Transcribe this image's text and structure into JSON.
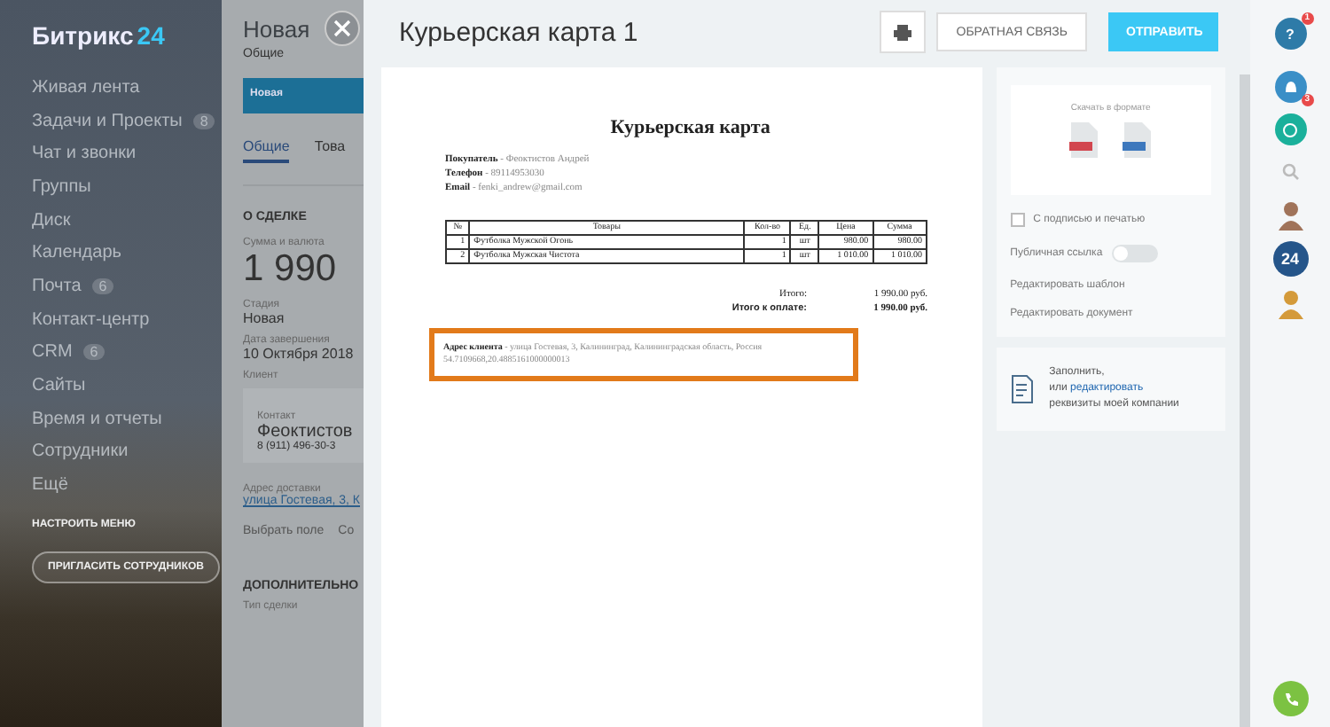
{
  "sidebar": {
    "logo": "Битрикс",
    "logo_suffix": "24",
    "items": [
      {
        "label": "Живая лента"
      },
      {
        "label": "Задачи и Проекты",
        "badge": "8"
      },
      {
        "label": "Чат и звонки"
      },
      {
        "label": "Группы"
      },
      {
        "label": "Диск"
      },
      {
        "label": "Календарь"
      },
      {
        "label": "Почта",
        "badge": "6"
      },
      {
        "label": "Контакт-центр"
      },
      {
        "label": "CRM",
        "badge": "6"
      },
      {
        "label": "Сайты"
      },
      {
        "label": "Время и отчеты"
      },
      {
        "label": "Сотрудники"
      },
      {
        "label": "Ещё"
      }
    ],
    "configure_menu": "НАСТРОИТЬ МЕНЮ",
    "invite": "ПРИГЛАСИТЬ СОТРУДНИКОВ"
  },
  "deal": {
    "title": "Новая",
    "category": "Общие",
    "stage": "Новая",
    "tabs": [
      {
        "label": "Общие",
        "selected": true
      },
      {
        "label": "Това",
        "selected": false
      }
    ],
    "section": "О СДЕЛКЕ",
    "fields": [
      {
        "label": "Сумма и валюта",
        "value": "1 990",
        "kind": "big"
      },
      {
        "label": "Стадия",
        "value": "Новая",
        "kind": "text"
      },
      {
        "label": "Дата завершения",
        "value": "10 Октября 2018",
        "kind": "text"
      },
      {
        "label": "Клиент",
        "kind": "client"
      }
    ],
    "contact": {
      "label": "Контакт",
      "name": "Феоктистов",
      "phone": "8 (911) 496-30-3"
    },
    "address_label": "Адрес доставки",
    "address": "улица Гостевая, 3, К",
    "links": [
      "Выбрать поле",
      "Со"
    ],
    "section2": "ДОПОЛНИТЕЛЬНО",
    "field2": "Тип сделки"
  },
  "panel": {
    "title": "Курьерская карта 1",
    "feedback": "ОБРАТНАЯ СВЯЗЬ",
    "send": "ОТПРАВИТЬ",
    "document": {
      "heading": "Курьерская карта",
      "info": [
        {
          "label": "Покупатель",
          "value": "- Феоктистов Андрей"
        },
        {
          "label": "Телефон",
          "value": "- 89114953030"
        },
        {
          "label": "Email",
          "value": "- fenki_andrew@gmail.com"
        }
      ],
      "columns": [
        "№",
        "Товары",
        "Кол-во",
        "Ед.",
        "Цена",
        "Сумма"
      ],
      "rows": [
        [
          "1",
          "Футболка Мужской Огонь",
          "1",
          "шт",
          "980.00",
          "980.00"
        ],
        [
          "2",
          "Футболка Мужская Чистота",
          "1",
          "шт",
          "1 010.00",
          "1 010.00"
        ]
      ],
      "totals": [
        {
          "label": "Итого:",
          "value": "1 990.00 руб.",
          "bold": false
        },
        {
          "label": "Итого к оплате:",
          "value": "1 990.00 руб.",
          "bold": true
        }
      ],
      "address_label": "Адрес клиента",
      "address": "- улица Гостевая, 3, Калининград, Калининградская область, Россия 54.7109668,20.4885161000000013"
    },
    "download_label": "Скачать в формате",
    "signature": {
      "label": "С подписью и печатью",
      "checked": false
    },
    "public_link": {
      "label": "Публичная ссылка",
      "on": false
    },
    "actions": [
      "Редактировать шаблон",
      "Редактировать документ"
    ],
    "company": {
      "lead": "Заполнить,",
      "middle": "или",
      "link": "редактировать",
      "tail": "реквизиты моей компании"
    }
  },
  "rail": {
    "help": "?",
    "help_badge": "1",
    "notify_badge": "3",
    "logo": "24"
  }
}
